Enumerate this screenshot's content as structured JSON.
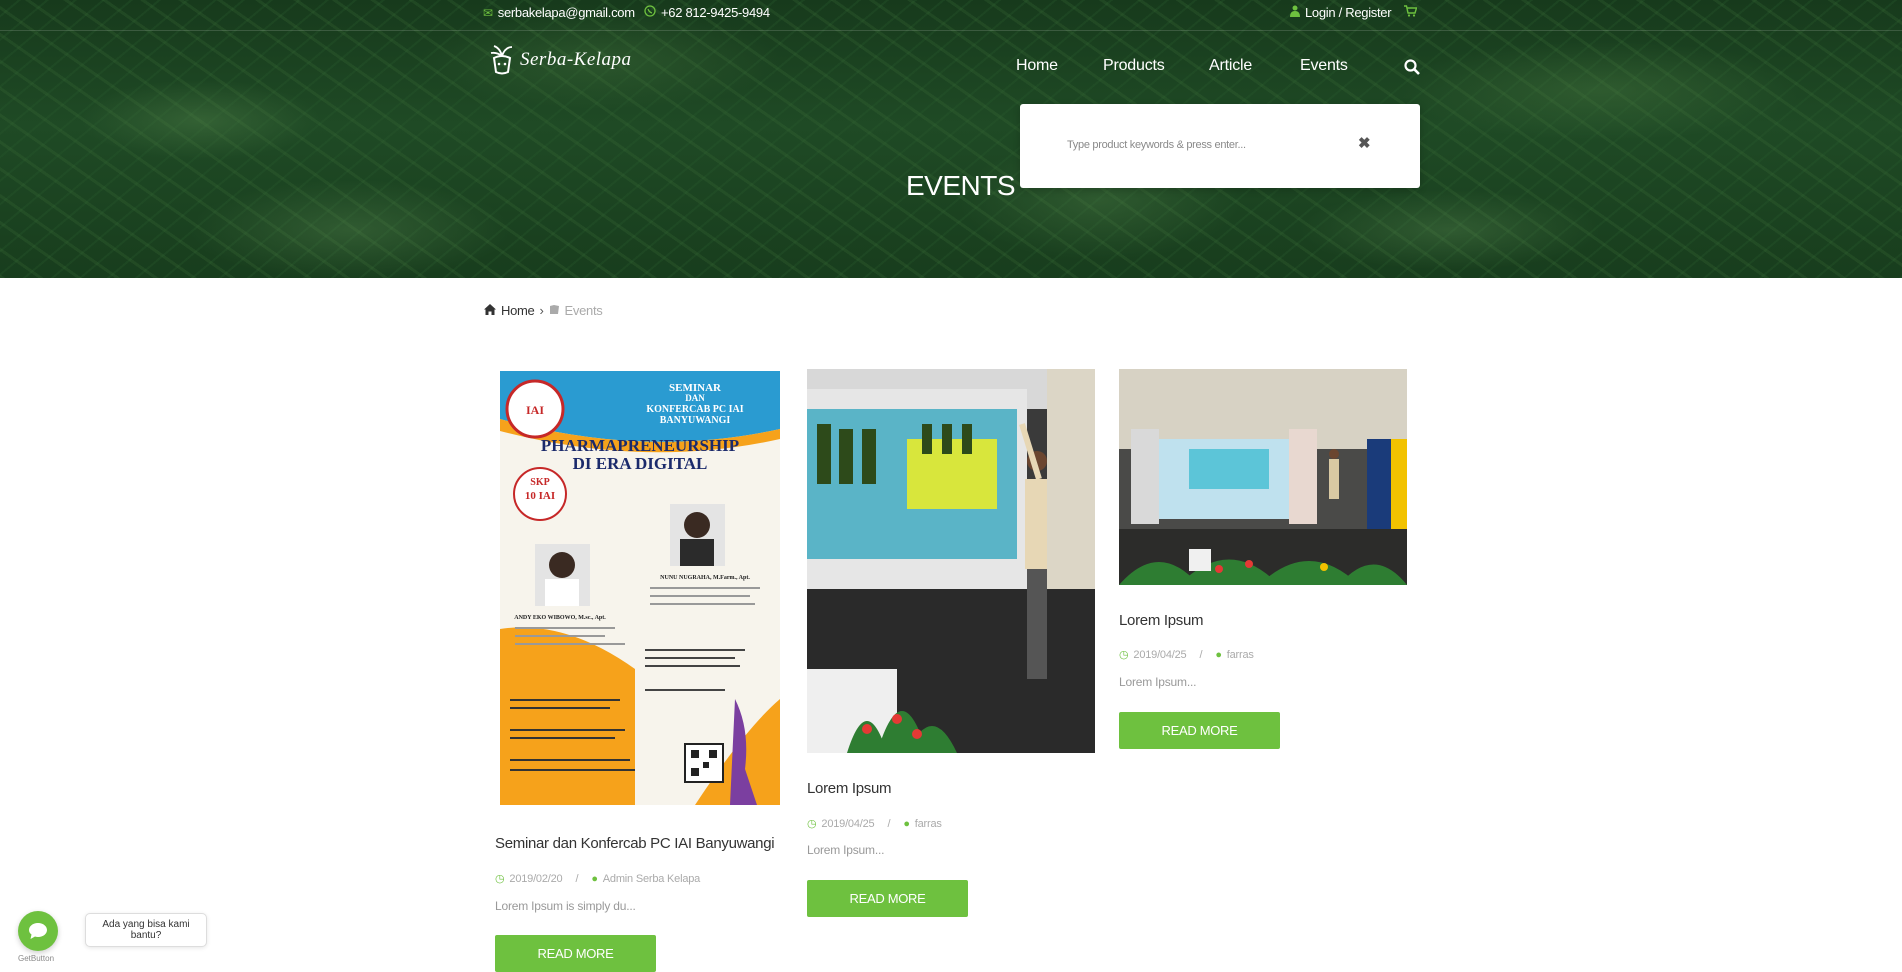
{
  "topbar": {
    "email": "serbakelapa@gmail.com",
    "phone": "+62 812-9425-9494",
    "login": "Login / Register"
  },
  "brand": {
    "name": "Serba-Kelapa"
  },
  "nav": {
    "items": [
      "Home",
      "Products",
      "Article",
      "Events"
    ]
  },
  "search": {
    "placeholder": "Type product keywords & press enter...",
    "close": "✖"
  },
  "page_title": "EVENTS",
  "breadcrumb": {
    "home": "Home",
    "separator": "›",
    "current": "Events"
  },
  "events": [
    {
      "title": "Seminar dan Konfercab PC IAI Banyuwangi",
      "date": "2019/02/20",
      "author": "Admin Serba Kelapa",
      "excerpt": "Lorem Ipsum is simply du...",
      "button": "READ MORE"
    },
    {
      "title": "Lorem Ipsum",
      "date": "2019/04/25",
      "author": "farras",
      "excerpt": "Lorem Ipsum...",
      "button": "READ MORE"
    },
    {
      "title": "Lorem Ipsum",
      "date": "2019/04/25",
      "author": "farras",
      "excerpt": "Lorem Ipsum...",
      "button": "READ MORE"
    }
  ],
  "poster": {
    "header_line1": "SEMINAR",
    "header_line2": "DAN",
    "header_line3": "KONFERCAB PC IAI",
    "header_line4": "BANYUWANGI",
    "headline1": "PHARMAPRENEURSHIP",
    "headline2": "DI ERA DIGITAL",
    "skp": "SKP",
    "skp_value": "10 IAI",
    "speaker1": "ANDY EKO WIBOWO, M.sc., Apt.",
    "speaker2": "NUNU NUGRAHA, M.Farm., Apt."
  },
  "chat": {
    "bubble": "Ada yang bisa kami bantu?",
    "label": "GetButton"
  },
  "colors": {
    "accent": "#6ec13f",
    "hero_bg": "#1f4a25"
  }
}
